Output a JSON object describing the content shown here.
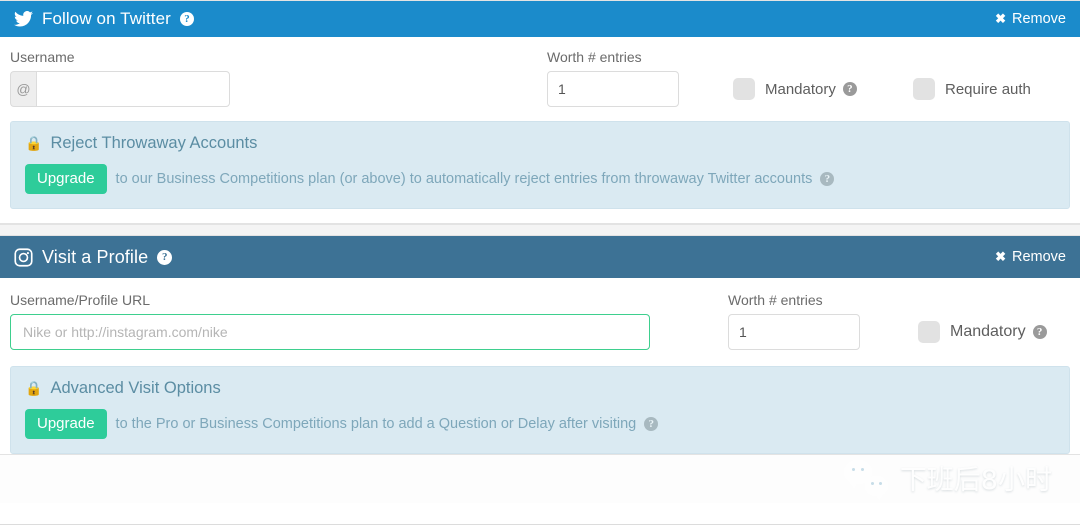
{
  "sections": [
    {
      "id": "follow-on-twitter",
      "icon": "twitter-bird-icon",
      "title": "Follow on Twitter",
      "remove_label": "Remove",
      "help": "?",
      "username_label": "Username",
      "username_prefix": "@",
      "username_value": "",
      "username_placeholder": "",
      "worth_label": "Worth # entries",
      "worth_value": "1",
      "mandatory_label": "Mandatory",
      "require_auth_label": "Require auth",
      "notice": {
        "lock": "lock-icon",
        "title": "Reject Throwaway Accounts",
        "button": "Upgrade",
        "text": "to our Business Competitions plan (or above) to automatically reject entries from throwaway Twitter accounts",
        "help": "?"
      }
    },
    {
      "id": "visit-a-profile",
      "icon": "instagram-icon",
      "title": "Visit a Profile",
      "remove_label": "Remove",
      "help": "?",
      "url_label": "Username/Profile URL",
      "url_value": "",
      "url_placeholder": "Nike or http://instagram.com/nike",
      "worth_label": "Worth # entries",
      "worth_value": "1",
      "mandatory_label": "Mandatory",
      "notice": {
        "lock": "lock-icon",
        "title": "Advanced Visit Options",
        "button": "Upgrade",
        "text": "to the Pro or Business Competitions plan to add a Question or Delay after visiting",
        "help": "?"
      }
    }
  ],
  "watermark": {
    "icon": "wechat-icon",
    "text": "下班后8小时"
  },
  "colors": {
    "twitter_header": "#1b8bcb",
    "instagram_header": "#3d7295",
    "upgrade_green": "#2ecc9a",
    "notice_bg": "#daeaf2",
    "focus_border": "#3ecf8e"
  }
}
